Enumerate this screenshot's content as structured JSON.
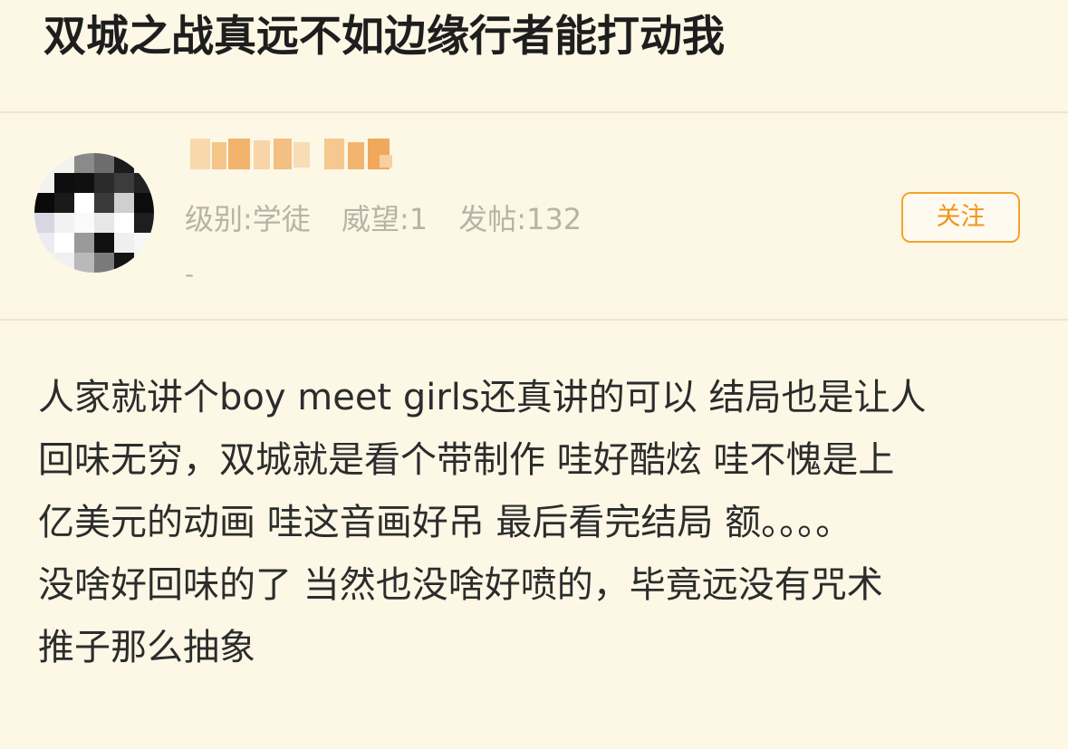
{
  "post": {
    "title": "双城之战真远不如边缘行者能打动我",
    "body_lines": [
      "人家就讲个boy meet girls还真讲的可以 结局也是让人",
      "回味无穷，双城就是看个带制作 哇好酷炫 哇不愧是上",
      "亿美元的动画 哇这音画好吊 最后看完结局 额。。。。",
      "没啥好回味的了 当然也没啥好喷的，毕竟远没有咒术",
      "推子那么抽象"
    ]
  },
  "author": {
    "avatar_icon": "pixelated-avatar-icon",
    "username_icon": "blurred-username",
    "level_label": "级别:学徒",
    "prestige_label": "威望:1",
    "posts_label": "发帖:132",
    "signature": "-"
  },
  "actions": {
    "follow_label": "关注"
  },
  "colors": {
    "background": "#fdf7e6",
    "accent": "#f3a32a",
    "muted_text": "#b9b3a6",
    "divider": "#efe6cf"
  }
}
